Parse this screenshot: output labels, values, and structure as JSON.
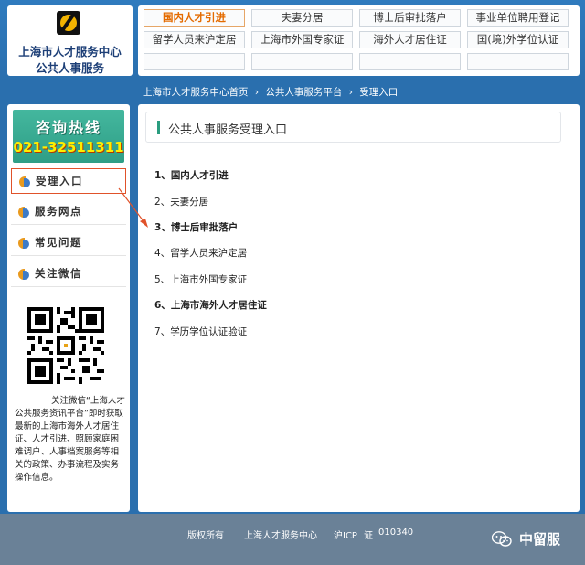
{
  "logo": {
    "line1": "上海市人才服务中心",
    "line2": "公共人事服务"
  },
  "topnav": {
    "row1": [
      "国内人才引进",
      "夫妻分居",
      "博士后审批落户",
      "事业单位聘用登记"
    ],
    "row2": [
      "留学人员来沪定居",
      "上海市外国专家证",
      "海外人才居住证",
      "国(境)外学位认证"
    ],
    "active_index": 0,
    "active_color": "#e46b00"
  },
  "breadcrumb": {
    "home": "上海市人才服务中心首页",
    "sep1": "›",
    "platform": "公共人事服务平台",
    "sep2": "›",
    "current": "受理入口"
  },
  "sidebar": {
    "hotline_title": "咨询热线",
    "hotline_number": "021-32511311",
    "items": [
      {
        "label": "受理入口",
        "active": true
      },
      {
        "label": "服务网点",
        "active": false
      },
      {
        "label": "常见问题",
        "active": false
      },
      {
        "label": "关注微信",
        "active": false
      }
    ],
    "qr_icon": "qr-code",
    "qr_description": "关注微信“上海人才公共服务资讯平台”即时获取最新的上海市海外人才居住证、人才引进、照顾家庭困难调户、人事档案服务等相关的政策、办事流程及实务操作信息。"
  },
  "main": {
    "title": "公共人事服务受理入口",
    "entries": [
      {
        "num": "1、",
        "label": "国内人才引进",
        "bold": true
      },
      {
        "num": "2、",
        "label": "夫妻分居",
        "bold": false
      },
      {
        "num": "3、",
        "label": "博士后审批落户",
        "bold": true
      },
      {
        "num": "4、",
        "label": "留学人员来沪定居",
        "bold": false
      },
      {
        "num": "5、",
        "label": "上海市外国专家证",
        "bold": false
      },
      {
        "num": "6、",
        "label": "上海市海外人才居住证",
        "bold": true
      },
      {
        "num": "7、",
        "label": "学历学位认证验证",
        "bold": false
      }
    ],
    "accent_color": "#2a9d7f"
  },
  "footer": {
    "rights": "版权所有",
    "org": "上海人才服务中心",
    "icp_label": "沪ICP",
    "icp_cert": "证",
    "icp_number": "010340",
    "wechat_name": "中留服",
    "wechat_icon": "wechat-icon"
  },
  "colors": {
    "page_blue": "#2a6fae",
    "footer_gray": "#6a8197",
    "hotline_green": "#2e9e86",
    "arrow_red": "#e0522a"
  }
}
